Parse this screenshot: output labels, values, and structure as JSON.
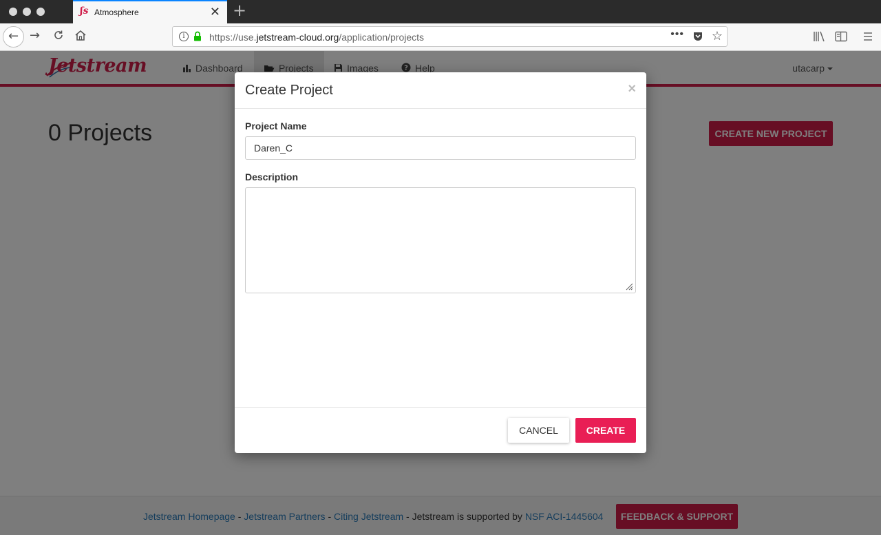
{
  "browser": {
    "tab_title": "Atmosphere",
    "tab_favicon": "ʃs",
    "url_prefix": "https://use.",
    "url_host": "jetstream-cloud.org",
    "url_path": "/application/projects"
  },
  "app": {
    "brand": "Jetstream",
    "menu": [
      {
        "label": "Dashboard",
        "icon": "bar-chart-icon"
      },
      {
        "label": "Projects",
        "icon": "folder-open-icon"
      },
      {
        "label": "Images",
        "icon": "floppy-disk-icon"
      },
      {
        "label": "Help",
        "icon": "question-circle-icon"
      }
    ],
    "user": "utacarp"
  },
  "page": {
    "heading": "0 Projects",
    "create_new_label": "CREATE NEW PROJECT"
  },
  "footer": {
    "link_homepage": "Jetstream Homepage",
    "sep1": " - ",
    "link_partners": "Jetstream Partners",
    "sep2": " - ",
    "link_citing": "Citing Jetstream",
    "support_text": " - Jetstream is supported by ",
    "link_nsf": "NSF ACI-1445604",
    "feedback_label": "FEEDBACK & SUPPORT"
  },
  "modal": {
    "title": "Create Project",
    "close_glyph": "×",
    "name_label": "Project Name",
    "name_value": "Daren_C",
    "description_label": "Description",
    "description_value": "",
    "cancel_label": "CANCEL",
    "create_label": "CREATE"
  },
  "colors": {
    "brand": "#cf1d49",
    "primary_button": "#e91e55",
    "link": "#2a7ab8"
  }
}
